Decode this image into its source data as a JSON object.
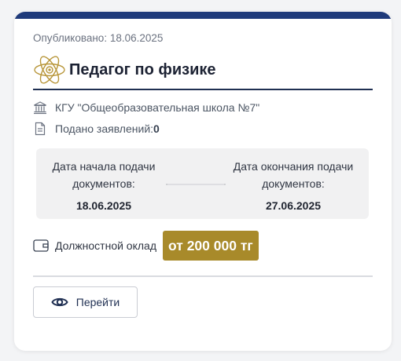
{
  "card": {
    "published": "Опубликовано: 18.06.2025",
    "title": "Педагог по физике",
    "school": "КГУ \"Общеобразовательная школа №7\"",
    "applications_label": "Подано заявлений: ",
    "applications_count": "0"
  },
  "dates": {
    "start_label": "Дата начала подачи документов:",
    "start_value": "18.06.2025",
    "end_label": "Дата окончания подачи документов:",
    "end_value": "27.06.2025"
  },
  "salary": {
    "label": "Должностной оклад",
    "value": "от 200 000 тг"
  },
  "actions": {
    "go_label": "Перейти"
  },
  "icons": {
    "title": "atom-icon",
    "school": "bank-building-icon",
    "applications": "document-icon",
    "salary": "wallet-icon",
    "go": "eye-icon"
  },
  "colors": {
    "top_bar": "#1f3a7a",
    "accent_gold": "#a88a2a",
    "title_underline": "#1f2f52"
  }
}
